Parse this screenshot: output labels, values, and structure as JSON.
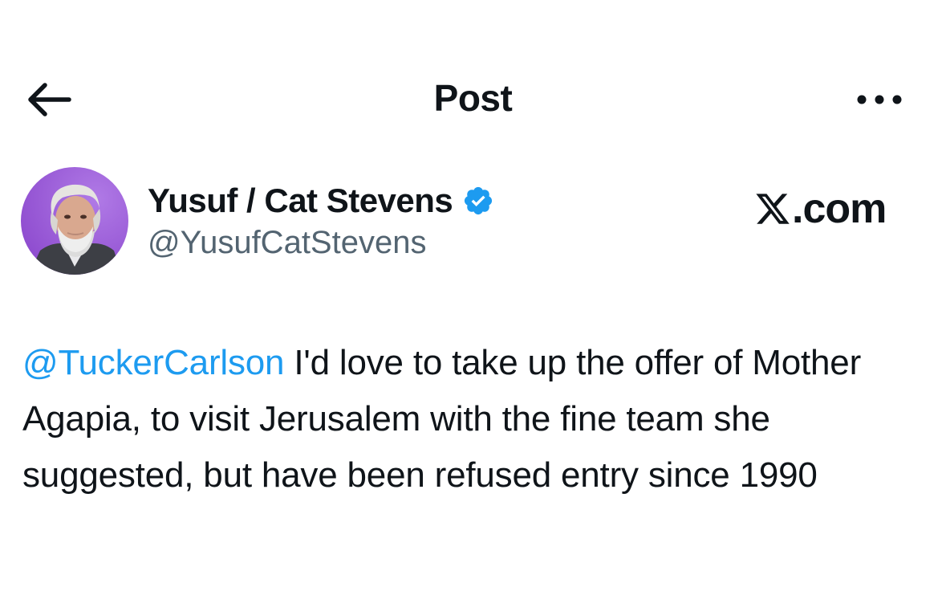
{
  "header": {
    "title": "Post",
    "back_icon": "arrow-left-icon",
    "more_icon": "more-horizontal-icon"
  },
  "author": {
    "display_name": "Yusuf / Cat Stevens",
    "handle": "@YusufCatStevens",
    "verified": true,
    "verified_badge_icon": "verified-badge-icon",
    "avatar_background_color": "#9b59d6"
  },
  "watermark": {
    "logo_icon": "x-logo-icon",
    "text": ".com"
  },
  "post": {
    "mention": "@TuckerCarlson",
    "text": " I'd love to take up the offer of Mother Agapia, to visit Jerusalem with the fine team she suggested, but have been refused entry since 1990"
  },
  "colors": {
    "link": "#1d9bf0",
    "verified": "#1d9bf0",
    "secondary_text": "#536471",
    "primary_text": "#0f1419"
  }
}
